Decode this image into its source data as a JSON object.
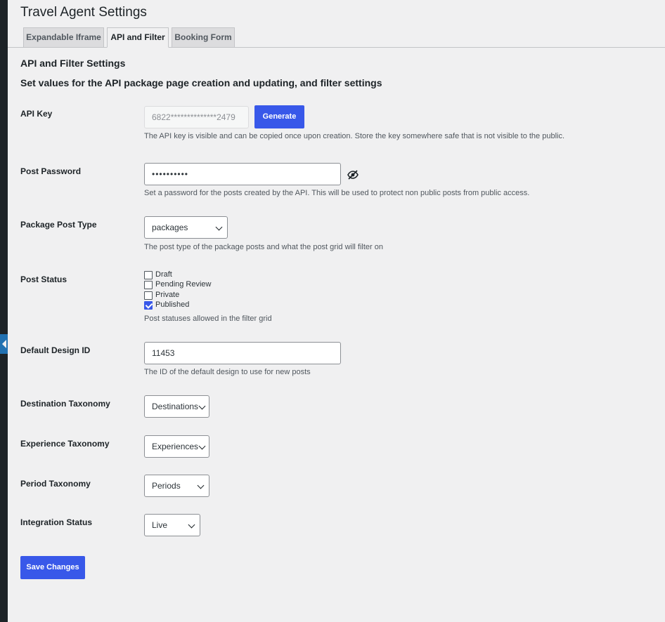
{
  "page": {
    "title": "Travel Agent Settings"
  },
  "tabs": [
    {
      "label": "Expandable Iframe"
    },
    {
      "label": "API and Filter"
    },
    {
      "label": "Booking Form"
    }
  ],
  "section": {
    "heading": "API and Filter Settings",
    "subheading": "Set values for the API package page creation and updating, and filter settings"
  },
  "api_key": {
    "label": "API Key",
    "value": "6822**************2479",
    "button": "Generate",
    "description": "The API key is visible and can be copied once upon creation. Store the key somewhere safe that is not visible to the public."
  },
  "post_password": {
    "label": "Post Password",
    "value": "••••••••••",
    "description": "Set a password for the posts created by the API. This will be used to protect non public posts from public access."
  },
  "package_post_type": {
    "label": "Package Post Type",
    "selected": "packages",
    "description": "The post type of the package posts and what the post grid will filter on"
  },
  "post_status": {
    "label": "Post Status",
    "options": [
      {
        "label": "Draft",
        "checked": false
      },
      {
        "label": "Pending Review",
        "checked": false
      },
      {
        "label": "Private",
        "checked": false
      },
      {
        "label": "Published",
        "checked": true
      }
    ],
    "description": "Post statuses allowed in the filter grid"
  },
  "default_design": {
    "label": "Default Design ID",
    "value": "11453",
    "description": "The ID of the default design to use for new posts"
  },
  "destination_taxonomy": {
    "label": "Destination Taxonomy",
    "selected": "Destinations"
  },
  "experience_taxonomy": {
    "label": "Experience Taxonomy",
    "selected": "Experiences"
  },
  "period_taxonomy": {
    "label": "Period Taxonomy",
    "selected": "Periods"
  },
  "integration_status": {
    "label": "Integration Status",
    "selected": "Live"
  },
  "save_button": "Save Changes",
  "colors": {
    "accent": "#3858e9",
    "background": "#f0f0f1",
    "admin_bar": "#1d2327"
  }
}
